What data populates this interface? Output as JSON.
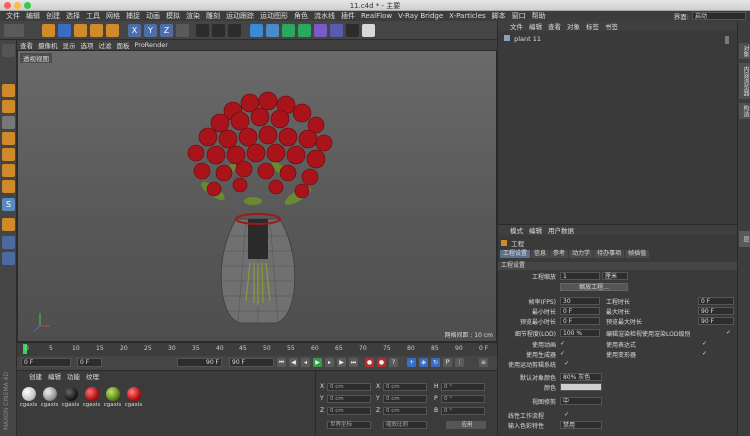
{
  "window": {
    "title": "11.c4d * - 主要"
  },
  "menubar": {
    "items": [
      "文件",
      "编辑",
      "创建",
      "选择",
      "工具",
      "网格",
      "捕捉",
      "动画",
      "模拟",
      "渲染",
      "雕刻",
      "运动跟踪",
      "运动图形",
      "角色",
      "流水线",
      "插件",
      "RealFlow",
      "V-Ray Bridge",
      "X-Particles",
      "脚本",
      "窗口",
      "帮助"
    ],
    "layout_label": "界面:",
    "layout_value": "启动"
  },
  "viewport": {
    "menu": [
      "查看",
      "摄像机",
      "显示",
      "选项",
      "过滤",
      "面板",
      "ProRender"
    ],
    "label": "透视视图",
    "grid_info": "网格间距 : 10 cm"
  },
  "timeline": {
    "ticks": [
      "0",
      "5",
      "10",
      "15",
      "20",
      "25",
      "30",
      "35",
      "40",
      "45",
      "50",
      "55",
      "60",
      "65",
      "70",
      "75",
      "80",
      "85",
      "90"
    ],
    "end_label": "0 F",
    "start_field": "0 F",
    "current_field": "0 F",
    "end_field": "90 F",
    "max_field": "90 F"
  },
  "materials": {
    "menu": [
      "创建",
      "编辑",
      "功能",
      "纹理"
    ],
    "items": [
      {
        "label": "cgaxis",
        "color": "#c8c8c8"
      },
      {
        "label": "cgaxis",
        "color": "#9a9a9a"
      },
      {
        "label": "cgaxis",
        "color": "#1c1c1c"
      },
      {
        "label": "cgaxis",
        "color": "#b01414"
      },
      {
        "label": "cgaxis",
        "color": "#5f8a1c"
      },
      {
        "label": "cgaxis",
        "color": "#c01010"
      }
    ]
  },
  "coordinates": {
    "rows": [
      {
        "axis": "X",
        "pos": "0 cm",
        "size": "0 cm",
        "rot_axis": "H",
        "rot": "0 °"
      },
      {
        "axis": "Y",
        "pos": "0 cm",
        "size": "0 cm",
        "rot_axis": "P",
        "rot": "0 °"
      },
      {
        "axis": "Z",
        "pos": "0 cm",
        "size": "0 cm",
        "rot_axis": "B",
        "rot": "0 °"
      }
    ],
    "mode_world": "世界坐标",
    "mode_scale": "缩放比例",
    "apply_label": "应用"
  },
  "objects": {
    "menu": [
      "文件",
      "编辑",
      "查看",
      "对象",
      "标签",
      "书签"
    ],
    "items": [
      "plant 11"
    ]
  },
  "attributes": {
    "menu": [
      "模式",
      "编辑",
      "用户数据"
    ],
    "title": "工程",
    "tabs": [
      "工程设置",
      "信息",
      "参考",
      "动力学",
      "待办事项",
      "帧插值"
    ],
    "section": "工程设置",
    "scale_label": "工程缩放",
    "scale_value": "1",
    "scale_unit": "厘米",
    "scale_button": "缩放工程...",
    "fps_label": "帧率(FPS)",
    "fps_value": "30",
    "time_label": "工程时长",
    "time_value": "0 F",
    "min_label": "最小时长",
    "min_value": "0 F",
    "max_label": "最大时长",
    "max_value": "90 F",
    "pmin_label": "预览最小时长",
    "pmin_value": "0 F",
    "pmax_label": "预览最大时长",
    "pmax_value": "90 F",
    "lod_label": "细节程度(LOD)",
    "lod_value": "100 %",
    "lod_edit_label": "编辑渲染检视使用渲染LOD级别",
    "use_anim": "使用动画",
    "use_expr": "使用表达式",
    "use_gen": "使用生成器",
    "use_deform": "使用变形器",
    "use_motion": "使用运动剪辑系统",
    "default_color_label": "默认对象颜色",
    "default_color_value": "80% 灰色",
    "color_label": "颜色",
    "view_clip_label": "视图修剪",
    "view_clip_value": "中",
    "linear_label": "线性工作流程",
    "input_label": "输入色彩特性",
    "input_value": "禁用"
  },
  "rightstrip": {
    "tabs": [
      "对象",
      "内容浏览器",
      "构造",
      "层"
    ]
  },
  "brand": "MAXON CINEMA 4D"
}
